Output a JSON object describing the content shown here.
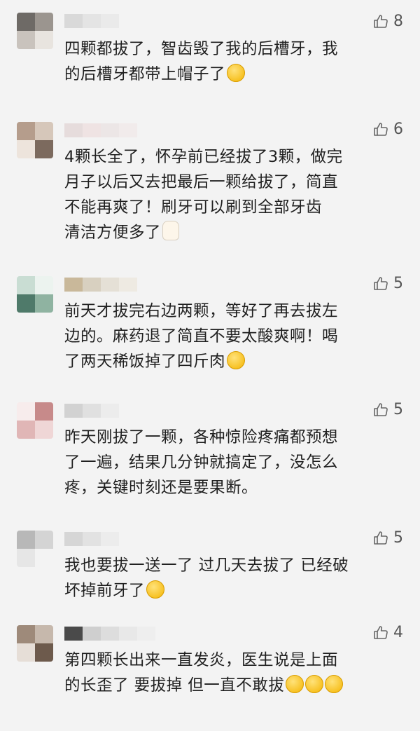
{
  "comments": [
    {
      "likes": "8",
      "lines": [
        "四颗都拔了，智齿毁了我的后槽牙，我",
        "的后槽牙都带上帽子了"
      ],
      "emoji": [
        "yellow-face"
      ]
    },
    {
      "likes": "6",
      "lines": [
        "4颗长全了，怀孕前已经拔了3颗，做完",
        "月子以后又去把最后一颗给拔了，简直",
        "不能再爽了！刷牙可以刷到全部牙齿",
        "清洁方便多了"
      ],
      "emoji": [
        "tooth"
      ]
    },
    {
      "likes": "5",
      "lines": [
        "前天才拔完右边两颗，等好了再去拔左",
        "边的。麻药退了简直不要太酸爽啊！喝",
        "了两天稀饭掉了四斤肉"
      ],
      "emoji": [
        "yellow-face"
      ]
    },
    {
      "likes": "5",
      "lines": [
        "昨天刚拔了一颗，各种惊险疼痛都预想",
        "了一遍，结果几分钟就搞定了，没怎么",
        "疼，关键时刻还是要果断。"
      ],
      "emoji": []
    },
    {
      "likes": "5",
      "lines": [
        "我也要拔一送一了 过几天去拔了 已经破",
        "坏掉前牙了"
      ],
      "emoji": [
        "yellow-face"
      ]
    },
    {
      "likes": "4",
      "lines": [
        "第四颗长出来一直发炎，医生说是上面",
        "的长歪了 要拔掉 但一直不敢拔"
      ],
      "emoji": [
        "yellow-face",
        "yellow-face",
        "yellow-face"
      ]
    }
  ],
  "colors": {
    "background": "#f3f3f3",
    "text": "#1f1f1f",
    "like": "#555555"
  }
}
